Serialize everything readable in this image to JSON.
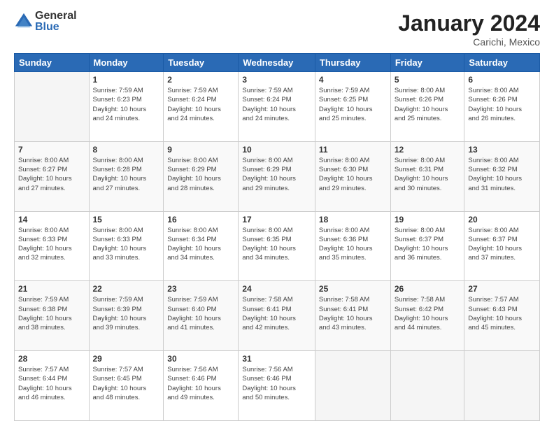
{
  "logo": {
    "general": "General",
    "blue": "Blue"
  },
  "title": "January 2024",
  "subtitle": "Carichi, Mexico",
  "weekdays": [
    "Sunday",
    "Monday",
    "Tuesday",
    "Wednesday",
    "Thursday",
    "Friday",
    "Saturday"
  ],
  "weeks": [
    [
      {
        "day": "",
        "info": ""
      },
      {
        "day": "1",
        "info": "Sunrise: 7:59 AM\nSunset: 6:23 PM\nDaylight: 10 hours\nand 24 minutes."
      },
      {
        "day": "2",
        "info": "Sunrise: 7:59 AM\nSunset: 6:24 PM\nDaylight: 10 hours\nand 24 minutes."
      },
      {
        "day": "3",
        "info": "Sunrise: 7:59 AM\nSunset: 6:24 PM\nDaylight: 10 hours\nand 24 minutes."
      },
      {
        "day": "4",
        "info": "Sunrise: 7:59 AM\nSunset: 6:25 PM\nDaylight: 10 hours\nand 25 minutes."
      },
      {
        "day": "5",
        "info": "Sunrise: 8:00 AM\nSunset: 6:26 PM\nDaylight: 10 hours\nand 25 minutes."
      },
      {
        "day": "6",
        "info": "Sunrise: 8:00 AM\nSunset: 6:26 PM\nDaylight: 10 hours\nand 26 minutes."
      }
    ],
    [
      {
        "day": "7",
        "info": "Sunrise: 8:00 AM\nSunset: 6:27 PM\nDaylight: 10 hours\nand 27 minutes."
      },
      {
        "day": "8",
        "info": "Sunrise: 8:00 AM\nSunset: 6:28 PM\nDaylight: 10 hours\nand 27 minutes."
      },
      {
        "day": "9",
        "info": "Sunrise: 8:00 AM\nSunset: 6:29 PM\nDaylight: 10 hours\nand 28 minutes."
      },
      {
        "day": "10",
        "info": "Sunrise: 8:00 AM\nSunset: 6:29 PM\nDaylight: 10 hours\nand 29 minutes."
      },
      {
        "day": "11",
        "info": "Sunrise: 8:00 AM\nSunset: 6:30 PM\nDaylight: 10 hours\nand 29 minutes."
      },
      {
        "day": "12",
        "info": "Sunrise: 8:00 AM\nSunset: 6:31 PM\nDaylight: 10 hours\nand 30 minutes."
      },
      {
        "day": "13",
        "info": "Sunrise: 8:00 AM\nSunset: 6:32 PM\nDaylight: 10 hours\nand 31 minutes."
      }
    ],
    [
      {
        "day": "14",
        "info": "Sunrise: 8:00 AM\nSunset: 6:33 PM\nDaylight: 10 hours\nand 32 minutes."
      },
      {
        "day": "15",
        "info": "Sunrise: 8:00 AM\nSunset: 6:33 PM\nDaylight: 10 hours\nand 33 minutes."
      },
      {
        "day": "16",
        "info": "Sunrise: 8:00 AM\nSunset: 6:34 PM\nDaylight: 10 hours\nand 34 minutes."
      },
      {
        "day": "17",
        "info": "Sunrise: 8:00 AM\nSunset: 6:35 PM\nDaylight: 10 hours\nand 34 minutes."
      },
      {
        "day": "18",
        "info": "Sunrise: 8:00 AM\nSunset: 6:36 PM\nDaylight: 10 hours\nand 35 minutes."
      },
      {
        "day": "19",
        "info": "Sunrise: 8:00 AM\nSunset: 6:37 PM\nDaylight: 10 hours\nand 36 minutes."
      },
      {
        "day": "20",
        "info": "Sunrise: 8:00 AM\nSunset: 6:37 PM\nDaylight: 10 hours\nand 37 minutes."
      }
    ],
    [
      {
        "day": "21",
        "info": "Sunrise: 7:59 AM\nSunset: 6:38 PM\nDaylight: 10 hours\nand 38 minutes."
      },
      {
        "day": "22",
        "info": "Sunrise: 7:59 AM\nSunset: 6:39 PM\nDaylight: 10 hours\nand 39 minutes."
      },
      {
        "day": "23",
        "info": "Sunrise: 7:59 AM\nSunset: 6:40 PM\nDaylight: 10 hours\nand 41 minutes."
      },
      {
        "day": "24",
        "info": "Sunrise: 7:58 AM\nSunset: 6:41 PM\nDaylight: 10 hours\nand 42 minutes."
      },
      {
        "day": "25",
        "info": "Sunrise: 7:58 AM\nSunset: 6:41 PM\nDaylight: 10 hours\nand 43 minutes."
      },
      {
        "day": "26",
        "info": "Sunrise: 7:58 AM\nSunset: 6:42 PM\nDaylight: 10 hours\nand 44 minutes."
      },
      {
        "day": "27",
        "info": "Sunrise: 7:57 AM\nSunset: 6:43 PM\nDaylight: 10 hours\nand 45 minutes."
      }
    ],
    [
      {
        "day": "28",
        "info": "Sunrise: 7:57 AM\nSunset: 6:44 PM\nDaylight: 10 hours\nand 46 minutes."
      },
      {
        "day": "29",
        "info": "Sunrise: 7:57 AM\nSunset: 6:45 PM\nDaylight: 10 hours\nand 48 minutes."
      },
      {
        "day": "30",
        "info": "Sunrise: 7:56 AM\nSunset: 6:46 PM\nDaylight: 10 hours\nand 49 minutes."
      },
      {
        "day": "31",
        "info": "Sunrise: 7:56 AM\nSunset: 6:46 PM\nDaylight: 10 hours\nand 50 minutes."
      },
      {
        "day": "",
        "info": ""
      },
      {
        "day": "",
        "info": ""
      },
      {
        "day": "",
        "info": ""
      }
    ]
  ]
}
